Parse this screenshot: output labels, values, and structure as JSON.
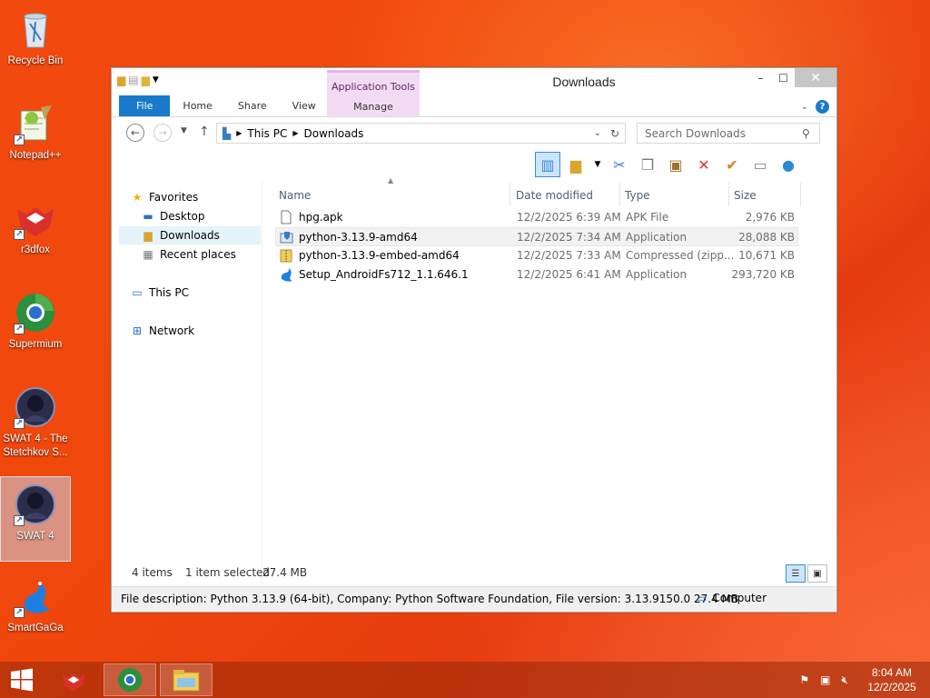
{
  "desktop": {
    "icons": [
      {
        "label": "Recycle Bin",
        "icon": "recycle-bin-icon"
      },
      {
        "label": "Notepad++",
        "icon": "notepad-plus-plus-icon"
      },
      {
        "label": "r3dfox",
        "icon": "r3dfox-icon"
      },
      {
        "label": "Supermium",
        "icon": "supermium-icon"
      },
      {
        "label": "SWAT 4 - The Stetchkov S...",
        "icon": "swat4-icon"
      },
      {
        "label": "SWAT 4",
        "icon": "swat4-icon"
      },
      {
        "label": "SmartGaGa",
        "icon": "smartgaga-icon"
      }
    ]
  },
  "window": {
    "title": "Downloads",
    "context_tab": "Application Tools",
    "tabs": {
      "file": "File",
      "home": "Home",
      "share": "Share",
      "view": "View",
      "manage": "Manage"
    },
    "address": {
      "root": "This PC",
      "current": "Downloads"
    },
    "search_placeholder": "Search Downloads",
    "nav": {
      "favorites": "Favorites",
      "desktop": "Desktop",
      "downloads": "Downloads",
      "recent": "Recent places",
      "this_pc": "This PC",
      "network": "Network"
    },
    "columns": {
      "name": "Name",
      "date": "Date modified",
      "type": "Type",
      "size": "Size"
    },
    "files": [
      {
        "name": "hpg.apk",
        "date": "12/2/2025 6:39 AM",
        "type": "APK File",
        "size": "2,976 KB",
        "icon": "file-icon"
      },
      {
        "name": "python-3.13.9-amd64",
        "date": "12/2/2025 7:34 AM",
        "type": "Application",
        "size": "28,088 KB",
        "icon": "installer-icon"
      },
      {
        "name": "python-3.13.9-embed-amd64",
        "date": "12/2/2025 7:33 AM",
        "type": "Compressed (zipp...",
        "size": "10,671 KB",
        "icon": "zip-folder-icon"
      },
      {
        "name": "Setup_AndroidFs712_1.1.646.1",
        "date": "12/2/2025 6:41 AM",
        "type": "Application",
        "size": "293,720 KB",
        "icon": "setup-icon"
      }
    ],
    "status": {
      "items": "4 items",
      "selected": "1 item selected",
      "size": "27.4 MB"
    },
    "description": "File description: Python 3.13.9 (64-bit), Company: Python Software Foundation, File version: 3.13.9150.0  27.4 MB",
    "computer": "Computer"
  },
  "taskbar": {
    "clock_time": "8:04 AM",
    "clock_date": "12/2/2025"
  }
}
